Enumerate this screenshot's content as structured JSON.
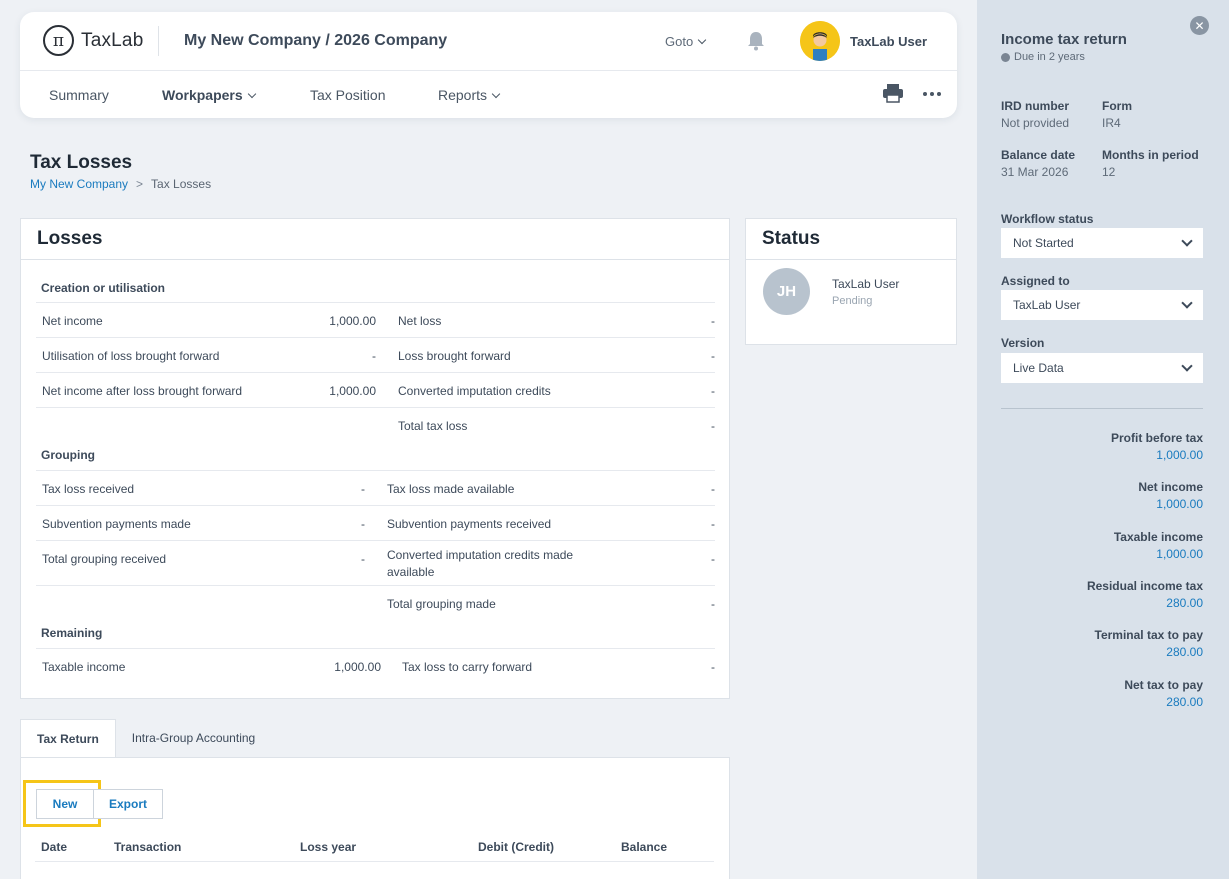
{
  "header": {
    "logo_symbol": "π",
    "logo_text": "TaxLab",
    "company": "My New Company / 2026 Company",
    "goto": "Goto",
    "user_name": "TaxLab User"
  },
  "nav": {
    "summary": "Summary",
    "workpapers": "Workpapers",
    "tax_position": "Tax Position",
    "reports": "Reports"
  },
  "page": {
    "title": "Tax Losses",
    "breadcrumb_root": "My New Company",
    "breadcrumb_sep": ">",
    "breadcrumb_current": "Tax Losses"
  },
  "losses": {
    "title": "Losses",
    "sections": {
      "creation": "Creation or utilisation",
      "grouping": "Grouping",
      "remaining": "Remaining"
    },
    "creation_rows": [
      {
        "l": "Net income",
        "lv": "1,000.00",
        "r": "Net loss",
        "rv": "-"
      },
      {
        "l": "Utilisation of loss brought forward",
        "lv": "-",
        "r": "Loss brought forward",
        "rv": "-"
      },
      {
        "l": "Net income after loss brought forward",
        "lv": "1,000.00",
        "r": "Converted imputation credits",
        "rv": "-"
      },
      {
        "l": "",
        "lv": "",
        "r": "Total tax loss",
        "rv": "-"
      }
    ],
    "grouping_rows": [
      {
        "l": "Tax loss received",
        "lv": "-",
        "r": "Tax loss made available",
        "rv": "-"
      },
      {
        "l": "Subvention payments made",
        "lv": "-",
        "r": "Subvention payments received",
        "rv": "-"
      },
      {
        "l": "Total grouping received",
        "lv": "-",
        "r": "Converted imputation credits made available",
        "rv": "-"
      },
      {
        "l": "",
        "lv": "",
        "r": "Total grouping made",
        "rv": "-"
      }
    ],
    "remaining_rows": [
      {
        "l": "Taxable income",
        "lv": "1,000.00",
        "r": "Tax loss to carry forward",
        "rv": "-"
      }
    ]
  },
  "status": {
    "title": "Status",
    "initials": "JH",
    "user": "TaxLab User",
    "state": "Pending"
  },
  "tabs": {
    "tax_return": "Tax Return",
    "intra_group": "Intra-Group Accounting"
  },
  "actions": {
    "new": "New",
    "export": "Export"
  },
  "table": {
    "columns": [
      "Date",
      "Transaction",
      "Loss year",
      "Debit (Credit)",
      "Balance"
    ]
  },
  "panel": {
    "title": "Income tax return",
    "due": "Due in 2 years",
    "ird_label": "IRD number",
    "ird_value": "Not provided",
    "form_label": "Form",
    "form_value": "IR4",
    "balance_label": "Balance date",
    "balance_value": "31 Mar 2026",
    "months_label": "Months in period",
    "months_value": "12",
    "workflow_label": "Workflow status",
    "workflow_value": "Not Started",
    "assigned_label": "Assigned to",
    "assigned_value": "TaxLab User",
    "version_label": "Version",
    "version_value": "Live Data",
    "summary": [
      {
        "label": "Profit before tax",
        "value": "1,000.00"
      },
      {
        "label": "Net income",
        "value": "1,000.00"
      },
      {
        "label": "Taxable income",
        "value": "1,000.00"
      },
      {
        "label": "Residual income tax",
        "value": "280.00"
      },
      {
        "label": "Terminal tax to pay",
        "value": "280.00"
      },
      {
        "label": "Net tax to pay",
        "value": "280.00"
      }
    ]
  },
  "colors": {
    "accent": "#1a7bbf",
    "highlight": "#f5c518",
    "panel_bg": "#d9e1ea"
  }
}
